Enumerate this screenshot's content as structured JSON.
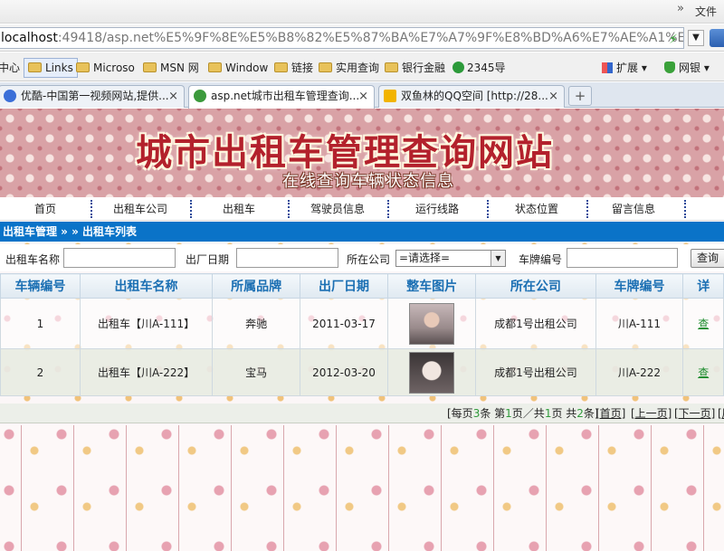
{
  "browser": {
    "right_menu": "文件",
    "arrows": "»",
    "url_host": "localhost",
    "url_rest": ":49418/asp.net%E5%9F%8E%E5%B8%82%E5%87%BA%E7%A7%9F%E8%BD%A6%E7%AE%A1%E7%",
    "favorites": [
      "中心",
      "Links",
      "Microso",
      "MSN 网",
      "Window",
      "链接",
      "实用查询",
      "银行金融",
      "2345导",
      "扩展",
      "网银"
    ],
    "tabs": [
      {
        "label": "优酷-中国第一视频网站,提供...",
        "icon_color": "#3b6fd8"
      },
      {
        "label": "asp.net城市出租车管理查询...",
        "icon_color": "#3c9a3c"
      },
      {
        "label": "双鱼林的QQ空间 [http://28...",
        "icon_color": "#f2b400"
      }
    ],
    "close_glyph": "×",
    "new_tab_glyph": "+"
  },
  "banner": {
    "title": "城市出租车管理查询网站",
    "subtitle": "在线查询车辆状态信息"
  },
  "nav": {
    "items": [
      "首页",
      "出租车公司",
      "出租车",
      "驾驶员信息",
      "运行线路",
      "状态位置",
      "留言信息"
    ]
  },
  "breadcrumb": "出租车管理 » » 出租车列表",
  "search": {
    "name_label": "出租车名称",
    "date_label": "出厂日期",
    "company_label": "所在公司",
    "company_selected": "=请选择=",
    "plate_label": "车牌编号",
    "query_button": "查询"
  },
  "table": {
    "headers": [
      "车辆编号",
      "出租车名称",
      "所属品牌",
      "出厂日期",
      "整车图片",
      "所在公司",
      "车牌编号",
      "详"
    ],
    "rows": [
      {
        "id": "1",
        "name": "出租车【川A-111】",
        "brand": "奔驰",
        "date": "2011-03-17",
        "company": "成都1号出租公司",
        "plate": "川A-111",
        "action": "查"
      },
      {
        "id": "2",
        "name": "出租车【川A-222】",
        "brand": "宝马",
        "date": "2012-03-20",
        "company": "成都1号出租公司",
        "plate": "川A-222",
        "action": "查"
      }
    ]
  },
  "pager": {
    "per_page_prefix": "[每页",
    "per_page": "3",
    "per_page_suffix": "条 第",
    "page": "1",
    "page_sep": "页／共",
    "pages": "1",
    "total_prefix": "页 共",
    "total": "2",
    "total_suffix": "条]",
    "first": "[首页]",
    "prev": "[上一页]",
    "next": "[下一页]",
    "last": "[尾"
  }
}
